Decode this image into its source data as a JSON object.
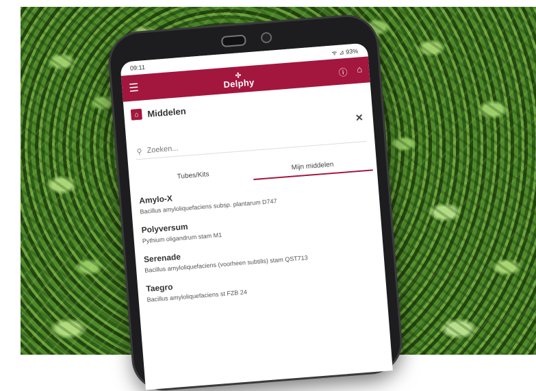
{
  "status": {
    "time": "09:11",
    "icons": "ᯤ ⊿ 93%"
  },
  "app": {
    "logo_text": "Delphy"
  },
  "page": {
    "title": "Middelen"
  },
  "search": {
    "placeholder": "Zoeken..."
  },
  "tabs": [
    {
      "label": "Tubes/Kits"
    },
    {
      "label": "Mijn middelen"
    }
  ],
  "items": [
    {
      "name": "Amylo-X",
      "desc": "Bacillus amyloliquefaciens subsp. plantarum D747"
    },
    {
      "name": "Polyversum",
      "desc": "Pythium oligandrum stam M1"
    },
    {
      "name": "Serenade",
      "desc": "Bacillus amyloliquefaciens (voorheen subtilis) stam QST713"
    },
    {
      "name": "Taegro",
      "desc": "Bacillus amyloliquefaciens st FZB 24"
    }
  ],
  "colors": {
    "brand": "#a3173f"
  }
}
